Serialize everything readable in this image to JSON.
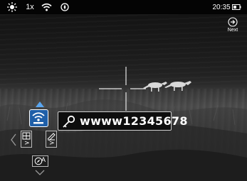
{
  "status_bar": {
    "zoom": "1x",
    "time": "20:35",
    "icons": [
      "brightness-icon",
      "wifi-icon",
      "compass-icon",
      "battery-icon"
    ]
  },
  "next_button": {
    "label": "Next",
    "icon": "next-arrow-icon"
  },
  "menu": {
    "selected_item": "wifi",
    "items": [
      {
        "name": "wifi",
        "icon": "wifi-icon",
        "highlight_color": "#1f5fa8"
      },
      {
        "name": "grid-settings",
        "icon": "grid-icon",
        "arrow": ">"
      },
      {
        "name": "edit-settings",
        "icon": "edit-icon",
        "arrow": ">"
      },
      {
        "name": "compass-mode",
        "icon": "compass-icon",
        "label": "A"
      }
    ]
  },
  "password_popup": {
    "icon": "key-icon",
    "value": "wwww12345678"
  },
  "colors": {
    "accent": "#1f5fa8",
    "text": "#ffffff",
    "topbar_bg": "#000000"
  }
}
